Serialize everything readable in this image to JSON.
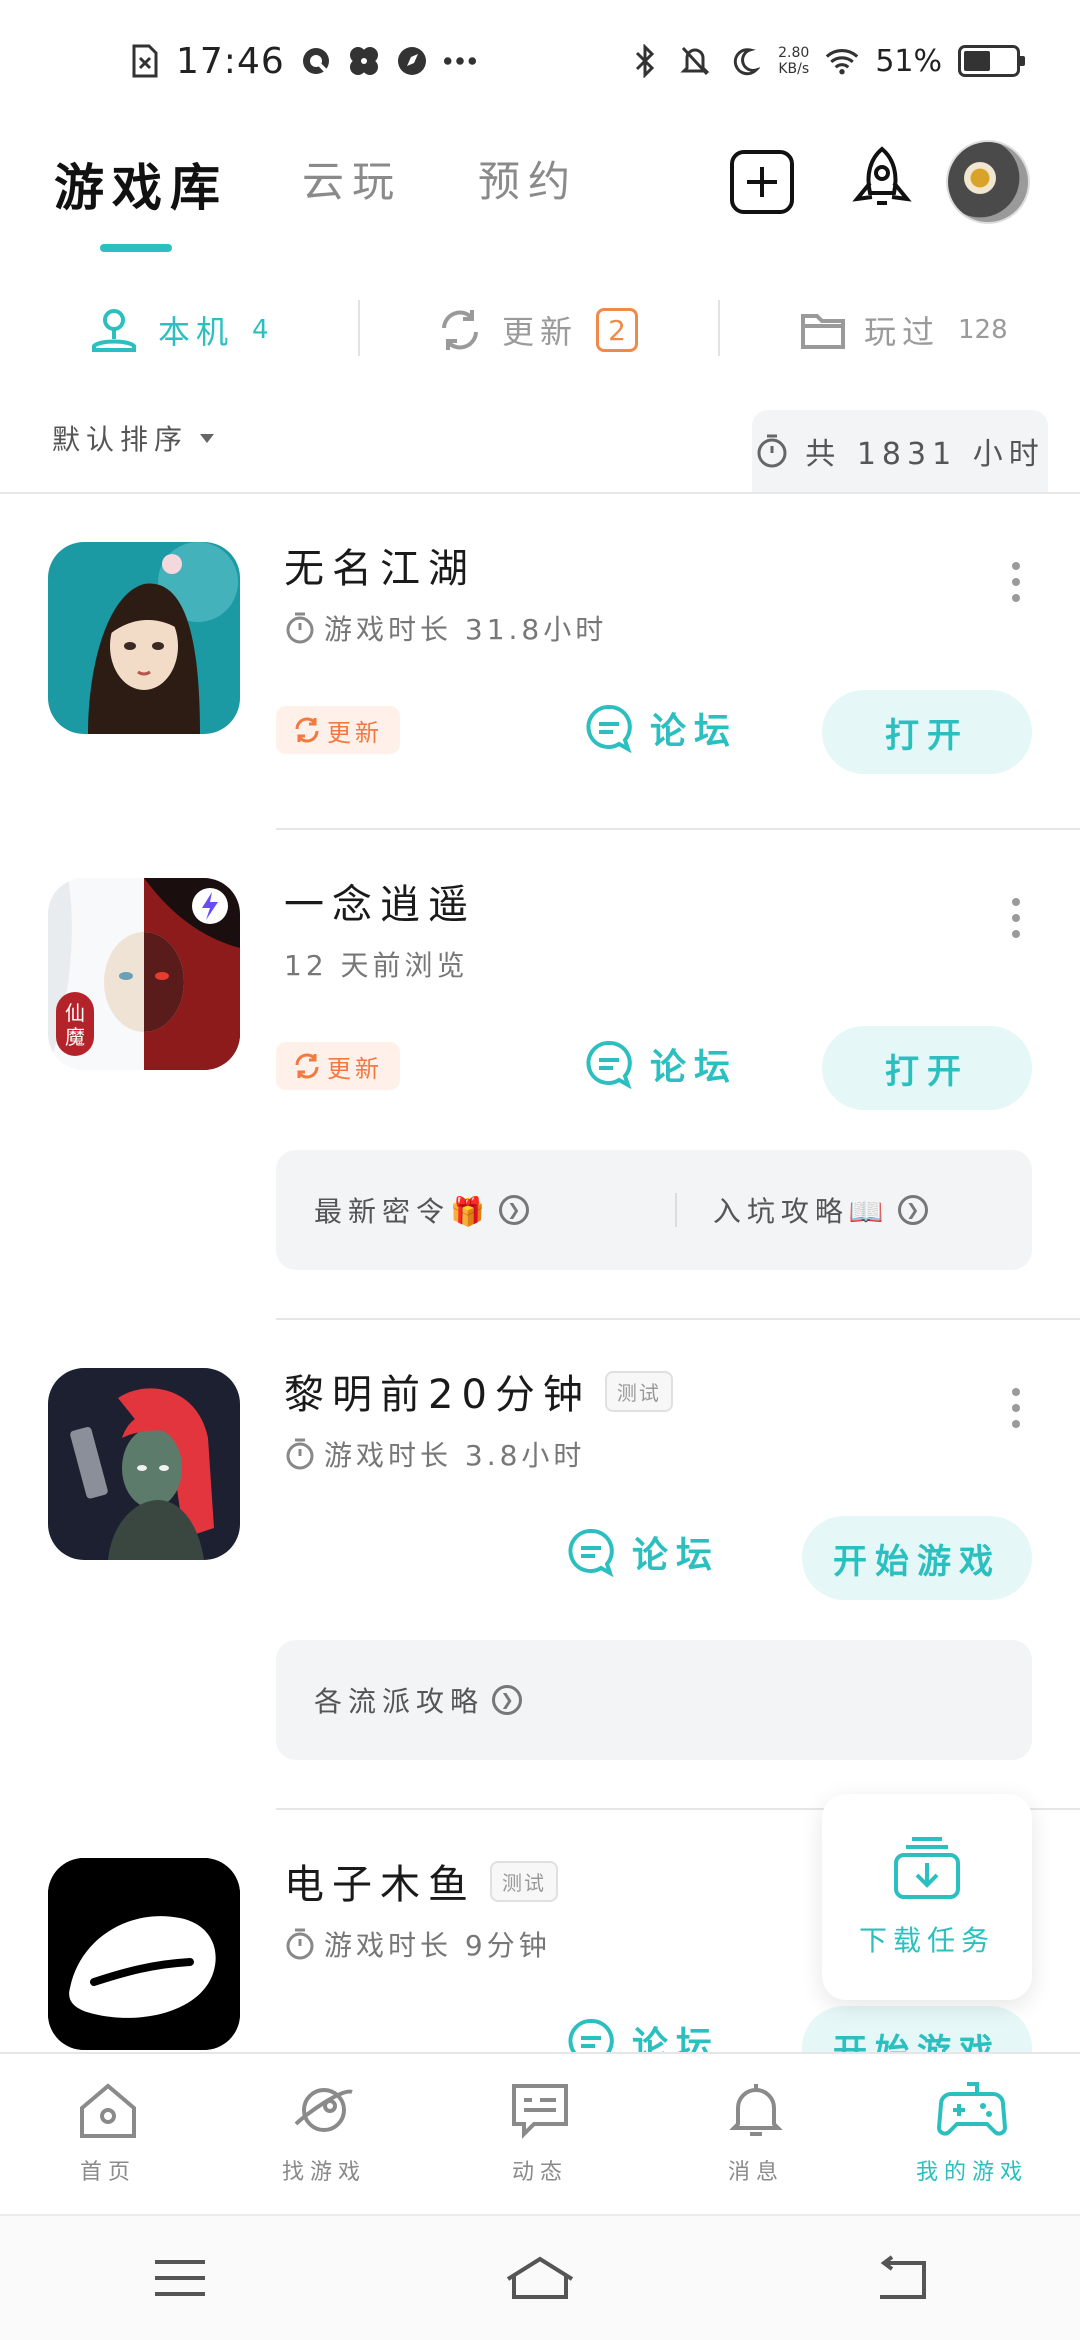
{
  "status_bar": {
    "time": "17:46",
    "net_speed_value": "2.80",
    "net_speed_unit": "KB/s",
    "battery_percent": "51%",
    "battery_level": 0.51
  },
  "header": {
    "tabs": [
      "游戏库",
      "云玩",
      "预约"
    ],
    "active_tab": 0,
    "accent_color": "#2bbfc0"
  },
  "filters": {
    "local": {
      "label": "本机",
      "count": "4"
    },
    "updates": {
      "label": "更新",
      "count": "2"
    },
    "played": {
      "label": "玩过",
      "count": "128"
    }
  },
  "sort": {
    "label": "默认排序",
    "total_time": "共 1831 小时"
  },
  "games": [
    {
      "title": "无名江湖",
      "subtitle": "游戏时长 31.8小时",
      "update_tag": "更新",
      "forum_label": "论坛",
      "action_label": "打开"
    },
    {
      "title": "一念逍遥",
      "subtitle": "12 天前浏览",
      "update_tag": "更新",
      "forum_label": "论坛",
      "action_label": "打开",
      "panel_items": [
        "最新密令🎁",
        "入坑攻略📖"
      ]
    },
    {
      "title": "黎明前20分钟",
      "tag": "测试",
      "subtitle": "游戏时长 3.8小时",
      "forum_label": "论坛",
      "action_label": "开始游戏",
      "panel_items": [
        "各流派攻略"
      ]
    },
    {
      "title": "电子木鱼",
      "tag": "测试",
      "subtitle": "游戏时长 9分钟",
      "forum_label": "论坛",
      "action_label": "开始游戏"
    }
  ],
  "download_fab": {
    "label": "下载任务"
  },
  "bottom_nav": {
    "items": [
      "首页",
      "找游戏",
      "动态",
      "消息",
      "我的游戏"
    ],
    "active": 4
  }
}
